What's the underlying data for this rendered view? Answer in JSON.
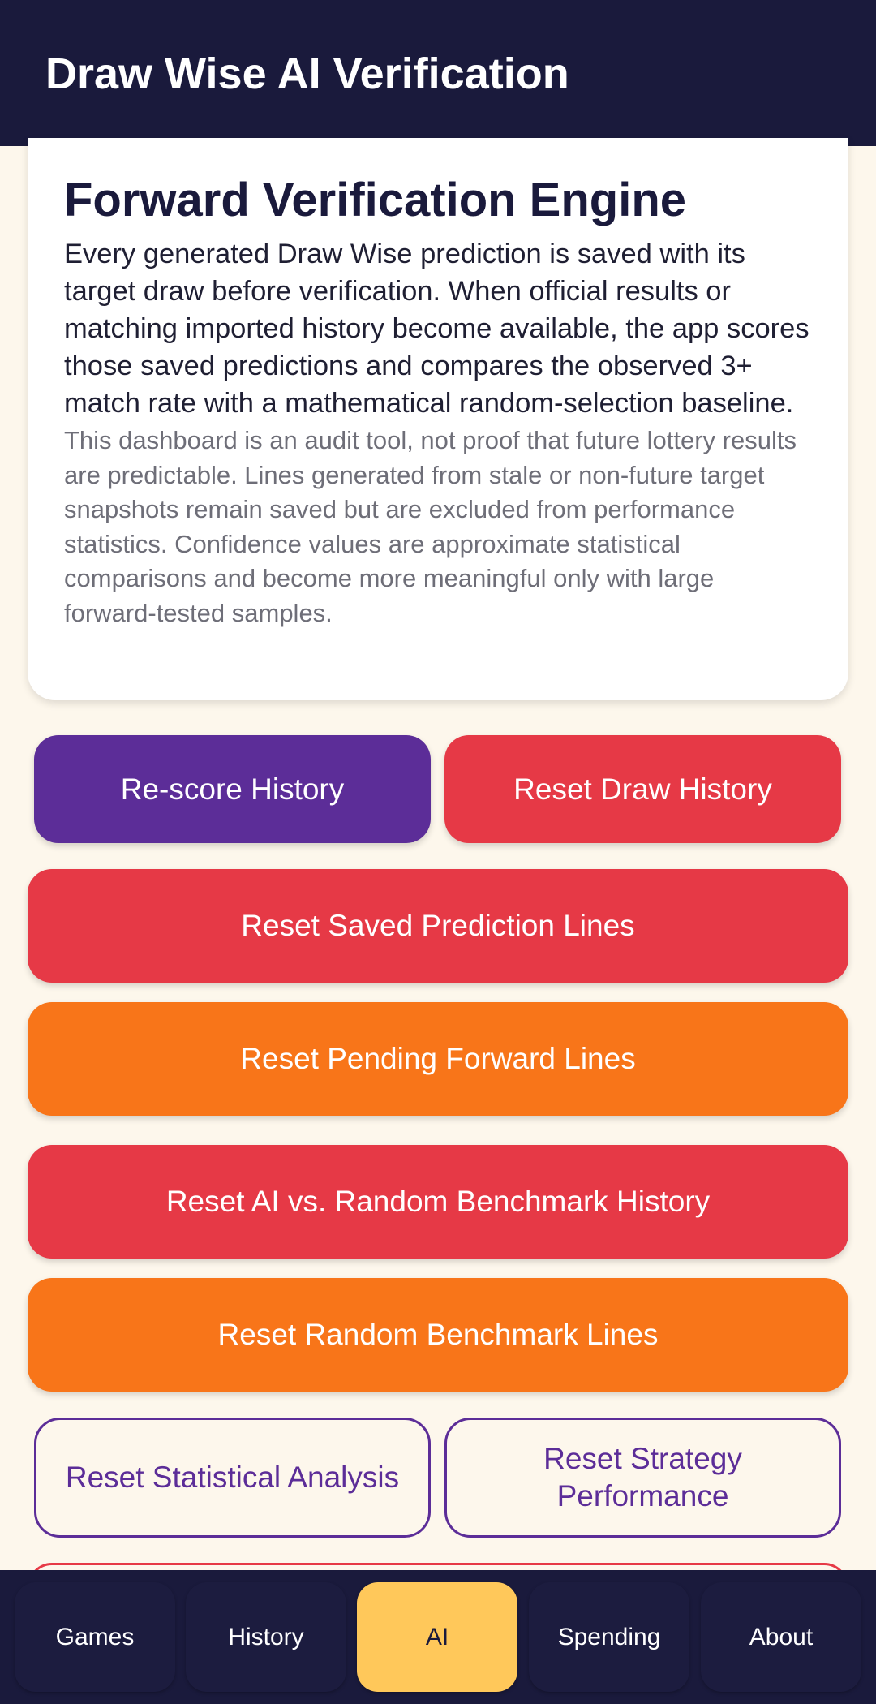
{
  "app_bar": {
    "title": "Draw Wise AI Verification"
  },
  "info_card": {
    "title": "Forward Verification Engine",
    "body": "Every generated Draw Wise prediction is saved with its target draw before verification. When official results or matching imported history become available, the app scores those saved predictions and compares the observed 3+ match rate with a mathematical random-selection baseline.",
    "note": "This dashboard is an audit tool, not proof that future lottery results are predictable. Lines generated from stale or non-future target snapshots remain saved but are excluded from performance statistics. Confidence values are approximate statistical comparisons and become more meaningful only with large forward-tested samples."
  },
  "actions": {
    "rescore_history": "Re-score History",
    "reset_draw_history": "Reset Draw History",
    "reset_saved_prediction_lines": "Reset Saved Prediction Lines",
    "reset_pending_forward_lines": "Reset Pending Forward Lines",
    "reset_ai_vs_random_benchmark_history": "Reset AI vs. Random Benchmark History",
    "reset_random_benchmark_lines": "Reset Random Benchmark Lines",
    "reset_statistical_analysis": "Reset Statistical Analysis",
    "reset_strategy_performance": "Reset Strategy Performance"
  },
  "bottom_nav": {
    "items": [
      {
        "label": "Games",
        "active": false
      },
      {
        "label": "History",
        "active": false
      },
      {
        "label": "AI",
        "active": true
      },
      {
        "label": "Spending",
        "active": false
      },
      {
        "label": "About",
        "active": false
      }
    ]
  },
  "colors": {
    "header_bg": "#1a1a3c",
    "page_bg": "#fdf7ec",
    "purple": "#5c2d98",
    "red": "#e63946",
    "orange": "#f87519",
    "active_nav": "#ffc85a"
  }
}
